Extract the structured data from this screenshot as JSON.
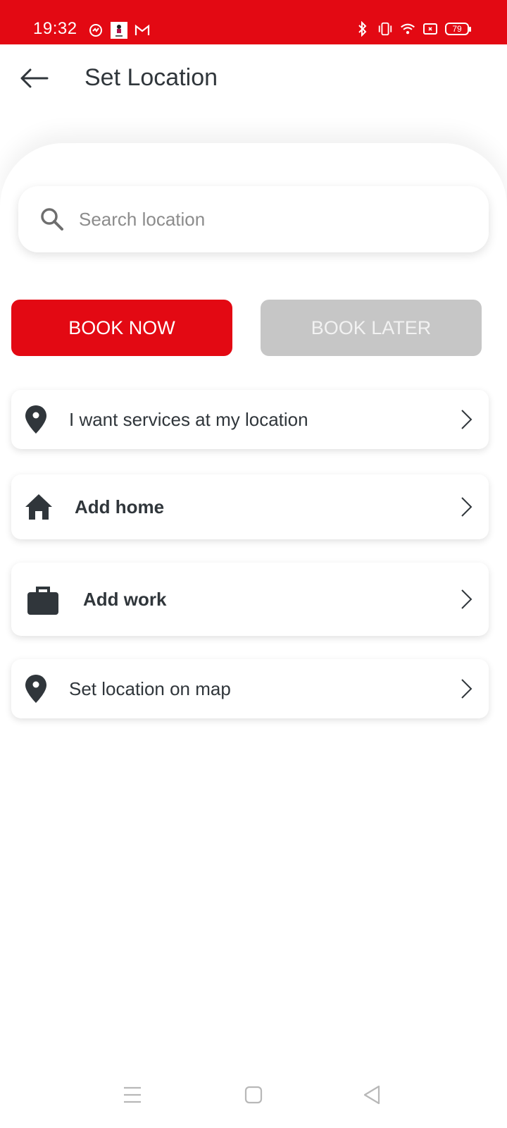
{
  "status_bar": {
    "time": "19:32",
    "left_icons": [
      "app-notification-icon",
      "app-thumbnail-icon",
      "gmail-icon"
    ],
    "right_icons": [
      "bluetooth-icon",
      "vibrate-icon",
      "wifi-icon",
      "screen-record-icon",
      "battery-icon"
    ],
    "battery_level": "79",
    "color": "#e30913"
  },
  "header": {
    "back_icon": "arrow-left-icon",
    "title": "Set Location"
  },
  "search": {
    "icon": "search-icon",
    "placeholder": "Search location",
    "value": ""
  },
  "booking": {
    "book_now_label": "BOOK NOW",
    "book_later_label": "BOOK LATER",
    "active": "BOOK NOW",
    "active_color": "#e30913",
    "inactive_color": "#c6c6c6"
  },
  "options": [
    {
      "icon": "location-pin-icon",
      "label": "I want services at my location"
    },
    {
      "icon": "home-icon",
      "label": "Add home"
    },
    {
      "icon": "briefcase-icon",
      "label": "Add work"
    },
    {
      "icon": "location-pin-icon",
      "label": "Set location on map"
    }
  ],
  "nav_bar": {
    "buttons": [
      "menu-icon",
      "home-square-icon",
      "back-triangle-icon"
    ]
  }
}
